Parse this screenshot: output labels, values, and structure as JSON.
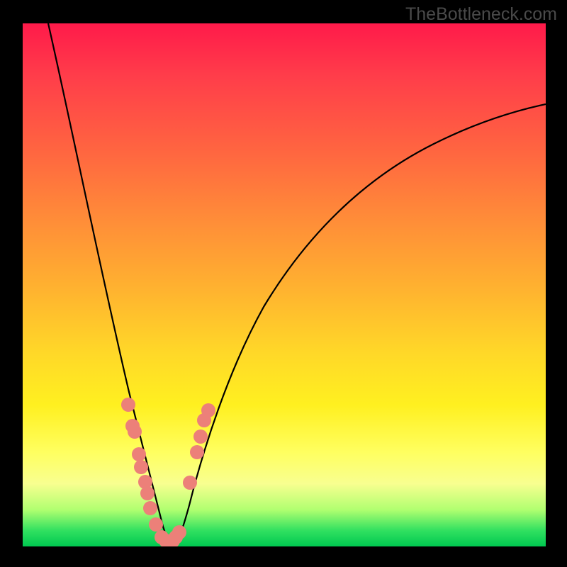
{
  "watermark": "TheBottleneck.com",
  "chart_data": {
    "type": "line",
    "title": "",
    "xlabel": "",
    "ylabel": "",
    "xlim": [
      0,
      100
    ],
    "ylim": [
      0,
      100
    ],
    "series": [
      {
        "name": "left-curve",
        "x": [
          5,
          7,
          9,
          11,
          13,
          15,
          17,
          19,
          20,
          21,
          22,
          23,
          24,
          25,
          26,
          27,
          28
        ],
        "y": [
          100,
          90,
          80,
          70,
          60,
          50,
          40,
          30,
          25,
          20,
          16,
          12,
          8,
          5,
          3,
          1.5,
          0.5
        ]
      },
      {
        "name": "right-curve",
        "x": [
          28,
          29,
          30,
          31,
          32,
          34,
          36,
          38,
          41,
          45,
          50,
          56,
          63,
          72,
          82,
          93,
          100
        ],
        "y": [
          0.5,
          2,
          5,
          9,
          13,
          20,
          27,
          33,
          40,
          47,
          54,
          60,
          66,
          72,
          77,
          81,
          83
        ]
      }
    ],
    "scatter": {
      "name": "data-points",
      "color": "#ec8079",
      "points": [
        {
          "x": 20.0,
          "y": 27.0
        },
        {
          "x": 20.8,
          "y": 23.0
        },
        {
          "x": 21.5,
          "y": 22.0
        },
        {
          "x": 22.2,
          "y": 17.5
        },
        {
          "x": 22.6,
          "y": 15.0
        },
        {
          "x": 23.3,
          "y": 12.0
        },
        {
          "x": 23.7,
          "y": 10.0
        },
        {
          "x": 24.3,
          "y": 7.0
        },
        {
          "x": 25.3,
          "y": 4.0
        },
        {
          "x": 26.4,
          "y": 1.5
        },
        {
          "x": 27.3,
          "y": 0.8
        },
        {
          "x": 28.5,
          "y": 0.8
        },
        {
          "x": 29.1,
          "y": 1.5
        },
        {
          "x": 29.8,
          "y": 2.5
        },
        {
          "x": 31.8,
          "y": 12.0
        },
        {
          "x": 33.2,
          "y": 18.0
        },
        {
          "x": 33.8,
          "y": 21.0
        },
        {
          "x": 34.6,
          "y": 24.0
        },
        {
          "x": 35.4,
          "y": 26.0
        }
      ]
    }
  }
}
